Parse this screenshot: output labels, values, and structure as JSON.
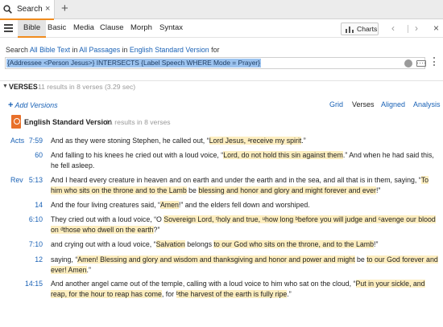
{
  "tab": {
    "label": "Search",
    "close": "×",
    "new_tab": "+"
  },
  "toolbar": {
    "tabs": [
      "Bible",
      "Basic",
      "Media",
      "Clause",
      "Morph",
      "Syntax"
    ],
    "active_tab": "Bible",
    "charts_label": "Charts",
    "back": "‹",
    "forward": "›",
    "close": "×"
  },
  "search": {
    "prefix": "Search ",
    "scope": "All Bible Text",
    "in1": " in ",
    "passages": "All Passages",
    "in2": " in ",
    "version": "English Standard Version",
    "suffix": " for",
    "query": "{Addressee <Person Jesus>} INTERSECTS {Label Speech WHERE Mode = Prayer}"
  },
  "verses": {
    "caret": "▼",
    "title": "VERSES",
    "count": "11 results in 8 verses (3.29 sec)",
    "add_versions": "Add Versions",
    "add_plus": "+",
    "views": [
      "Grid",
      "Verses",
      "Aligned",
      "Analysis"
    ],
    "active_view": "Verses",
    "version_name": "English Standard Version",
    "version_count": "11 results in 8 verses"
  },
  "results": [
    {
      "book": "Acts",
      "ref": "7:59",
      "segments": [
        {
          "t": "And as they were stoning Stephen, he called out, “",
          "h": 0
        },
        {
          "t": "Lord Jesus, ",
          "h": 1
        },
        {
          "t": "ᵃ",
          "h": 1
        },
        {
          "t": "receive my spirit",
          "h": 1
        },
        {
          "t": ".”",
          "h": 0
        }
      ]
    },
    {
      "book": "",
      "ref": "60",
      "segments": [
        {
          "t": "And falling to his knees he cried out with a loud voice, “",
          "h": 0
        },
        {
          "t": "Lord, do not hold this sin against them",
          "h": 1
        },
        {
          "t": ".” And when he had said this, he fell asleep.",
          "h": 0
        }
      ]
    },
    {
      "book": "Rev",
      "ref": "5:13",
      "segments": [
        {
          "t": "And I heard every creature in heaven and on earth and under the earth and in the sea, and all that is in them, saying, “",
          "h": 0
        },
        {
          "t": "To him who sits on the throne and to the Lamb",
          "h": 1
        },
        {
          "t": " be ",
          "h": 0
        },
        {
          "t": "blessing and honor and glory and might forever and ever",
          "h": 1
        },
        {
          "t": "!”",
          "h": 0
        }
      ]
    },
    {
      "book": "",
      "ref": "14",
      "segments": [
        {
          "t": "And the four living creatures said, “",
          "h": 0
        },
        {
          "t": "Amen",
          "h": 1
        },
        {
          "t": "!” and the elders fell down and worshiped.",
          "h": 0
        }
      ]
    },
    {
      "book": "",
      "ref": "6:10",
      "segments": [
        {
          "t": "They cried out with a loud voice, “O ",
          "h": 0
        },
        {
          "t": "Sovereign Lord, ",
          "h": 1
        },
        {
          "t": "ᵗholy and true, ",
          "h": 1
        },
        {
          "t": "ᵘhow long ",
          "h": 1
        },
        {
          "t": "ᵇbefore you will judge and ",
          "h": 1
        },
        {
          "t": "ᶜavenge our blood on ",
          "h": 1
        },
        {
          "t": "ᵈthose who dwell on the earth",
          "h": 1
        },
        {
          "t": "?”",
          "h": 0
        }
      ]
    },
    {
      "book": "",
      "ref": "7:10",
      "segments": [
        {
          "t": "and crying out with a loud voice, “",
          "h": 0
        },
        {
          "t": "Salvation",
          "h": 1
        },
        {
          "t": " belongs ",
          "h": 0
        },
        {
          "t": "to our God who sits on the throne, and to the Lamb",
          "h": 1
        },
        {
          "t": "!”",
          "h": 0
        }
      ]
    },
    {
      "book": "",
      "ref": "12",
      "segments": [
        {
          "t": "saying, “",
          "h": 0
        },
        {
          "t": "Amen! Blessing and glory and wisdom and thanksgiving and honor and power and might",
          "h": 1
        },
        {
          "t": " be ",
          "h": 0
        },
        {
          "t": "to our God forever and ever! Amen",
          "h": 1
        },
        {
          "t": ".”",
          "h": 0
        }
      ]
    },
    {
      "book": "",
      "ref": "14:15",
      "segments": [
        {
          "t": "And another angel came out of the temple, calling with a loud voice to him who sat on the cloud, “",
          "h": 0
        },
        {
          "t": "Put in your sickle, and reap, for the hour to reap has come",
          "h": 1
        },
        {
          "t": ", for ",
          "h": 0
        },
        {
          "t": "ᵇthe harvest of the earth is fully ripe",
          "h": 1
        },
        {
          "t": ".”",
          "h": 0
        }
      ]
    }
  ],
  "colors": {
    "accent": "#f08b1d",
    "link": "#1a62b6",
    "highlight": "#fdeec0",
    "selection": "#9cc3ef"
  }
}
